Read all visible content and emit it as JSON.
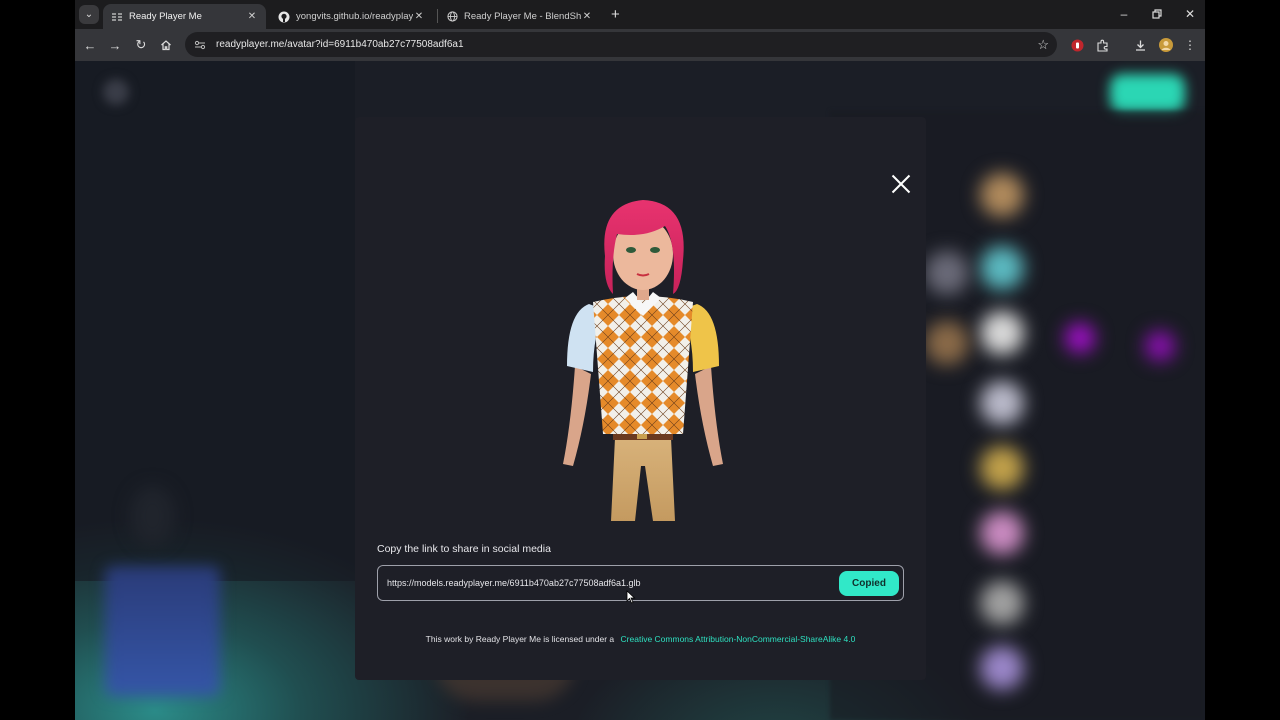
{
  "browser": {
    "tabs": [
      {
        "title": "Ready Player Me",
        "active": true,
        "icon": "ready-player-me-icon"
      },
      {
        "title": "yongvits.github.io/readyplayer/",
        "active": false,
        "icon": "github-icon"
      },
      {
        "title": "Ready Player Me - BlendShape",
        "active": false,
        "icon": "globe-icon"
      }
    ],
    "address": "readyplayer.me/avatar?id=6911b470ab27c77508adf6a1"
  },
  "modal": {
    "share_label": "Copy the link to share in social media",
    "link_value": "https://models.readyplayer.me/6911b470ab27c77508adf6a1.glb",
    "copy_button": "Copied",
    "license_text": "This work by Ready Player Me is licensed under a",
    "license_link": "Creative Commons Attribution-NonCommercial-ShareAlike 4.0"
  },
  "colors": {
    "accent": "#31e8c8",
    "link": "#2ee0c0",
    "modal_bg": "#1e1f27"
  }
}
